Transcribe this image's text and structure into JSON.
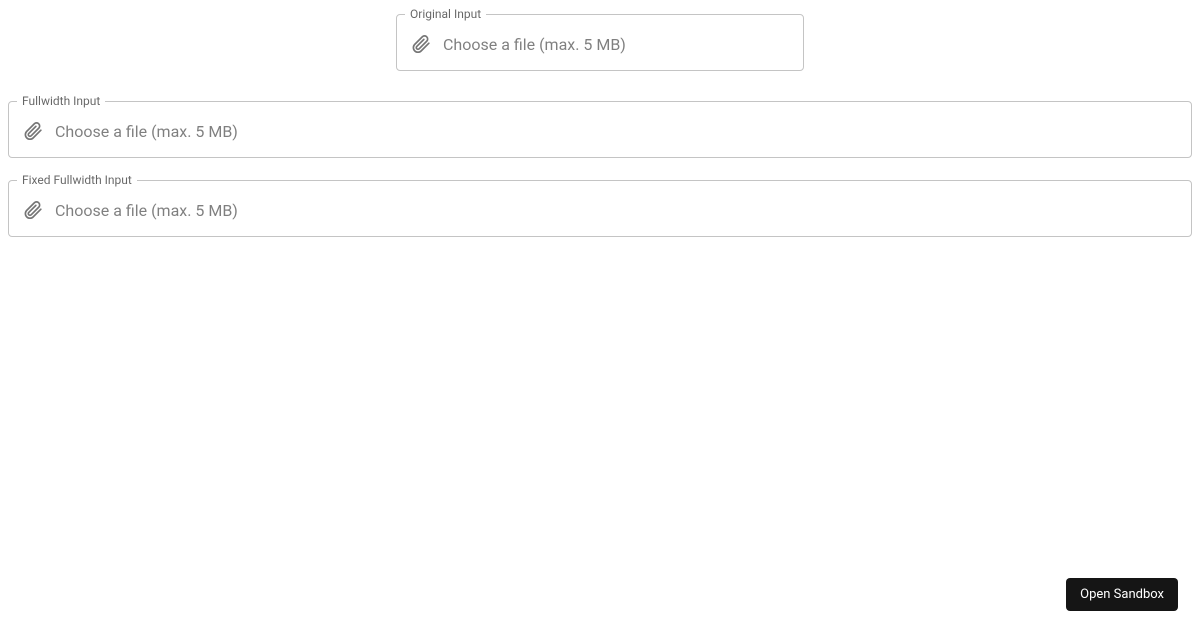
{
  "inputs": {
    "original": {
      "label": "Original Input",
      "placeholder": "Choose a file (max. 5 MB)"
    },
    "fullwidth": {
      "label": "Fullwidth Input",
      "placeholder": "Choose a file (max. 5 MB)"
    },
    "fixed_fullwidth": {
      "label": "Fixed Fullwidth Input",
      "placeholder": "Choose a file (max. 5 MB)"
    }
  },
  "sandbox": {
    "button_label": "Open Sandbox"
  }
}
